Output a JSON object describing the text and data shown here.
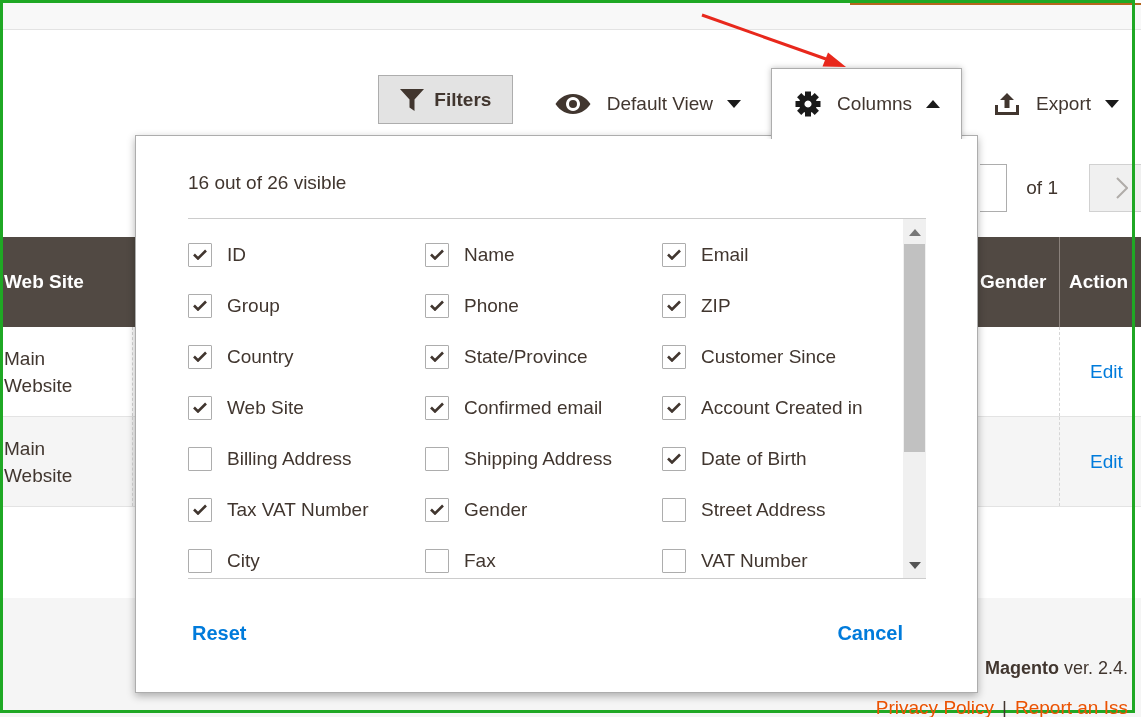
{
  "toolbar": {
    "filters": {
      "label": "Filters"
    },
    "dropdowns": [
      {
        "kind": "view",
        "label": "Default View",
        "expanded": false
      },
      {
        "kind": "columns",
        "label": "Columns",
        "expanded": true
      },
      {
        "kind": "export",
        "label": "Export",
        "expanded": false
      }
    ]
  },
  "pagination": {
    "total": "of 1"
  },
  "table": {
    "columns": [
      "Web Site",
      "Gender",
      "Action"
    ],
    "rows": [
      {
        "web_site": "Main Website",
        "action": "Edit"
      },
      {
        "web_site": "Main Website",
        "action": "Edit"
      }
    ]
  },
  "columns_panel": {
    "summary": "16 out of 26 visible",
    "items": [
      {
        "label": "ID",
        "checked": true
      },
      {
        "label": "Name",
        "checked": true
      },
      {
        "label": "Email",
        "checked": true
      },
      {
        "label": "Group",
        "checked": true
      },
      {
        "label": "Phone",
        "checked": true
      },
      {
        "label": "ZIP",
        "checked": true
      },
      {
        "label": "Country",
        "checked": true
      },
      {
        "label": "State/Province",
        "checked": true
      },
      {
        "label": "Customer Since",
        "checked": true
      },
      {
        "label": "Web Site",
        "checked": true
      },
      {
        "label": "Confirmed email",
        "checked": true
      },
      {
        "label": "Account Created in",
        "checked": true
      },
      {
        "label": "Billing Address",
        "checked": false
      },
      {
        "label": "Shipping Address",
        "checked": false
      },
      {
        "label": "Date of Birth",
        "checked": true
      },
      {
        "label": "Tax VAT Number",
        "checked": true
      },
      {
        "label": "Gender",
        "checked": true
      },
      {
        "label": "Street Address",
        "checked": false
      },
      {
        "label": "City",
        "checked": false
      },
      {
        "label": "Fax",
        "checked": false
      },
      {
        "label": "VAT Number",
        "checked": false
      }
    ],
    "actions": [
      {
        "kind": "reset",
        "label": "Reset"
      },
      {
        "kind": "cancel",
        "label": "Cancel"
      }
    ]
  },
  "footer": {
    "version": "**Magento** ver. 2.4.",
    "links": [
      "Privacy Policy",
      "Report an Iss"
    ],
    "separator": "|"
  }
}
